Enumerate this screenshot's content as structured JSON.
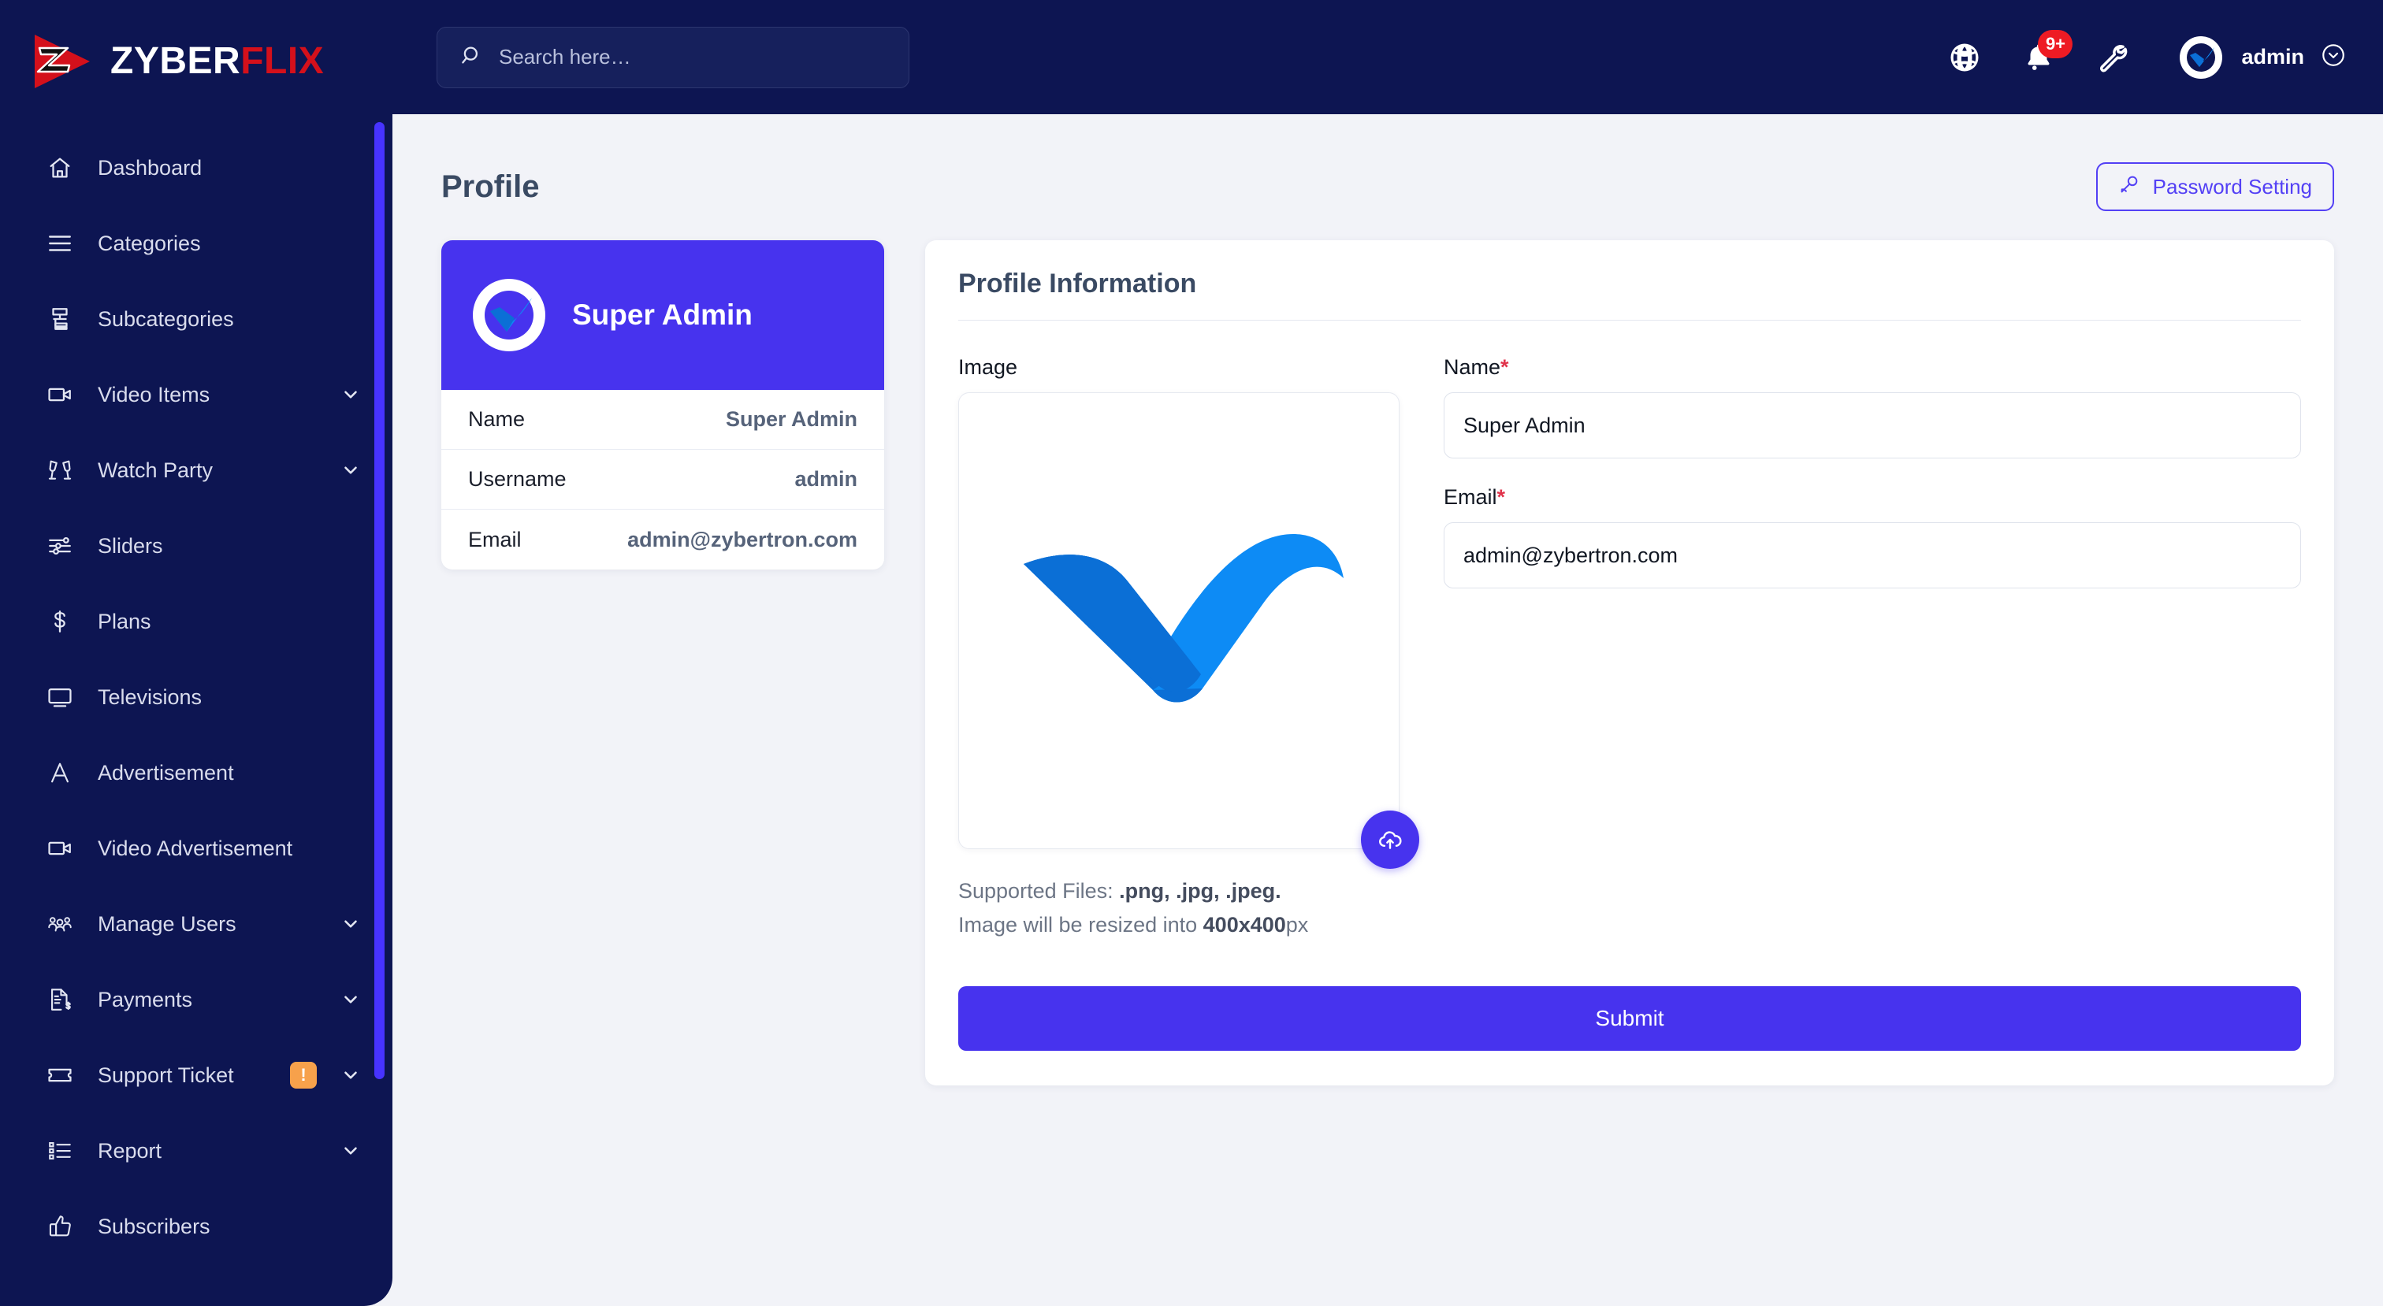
{
  "brand": {
    "name_white": "ZYBER",
    "name_red": "FLIX",
    "logo_icon": "play-z-logo-icon"
  },
  "sidebar": {
    "items": [
      {
        "label": "Dashboard",
        "icon": "home-icon",
        "chevron": false,
        "badge": null
      },
      {
        "label": "Categories",
        "icon": "list-lines-icon",
        "chevron": false,
        "badge": null
      },
      {
        "label": "Subcategories",
        "icon": "sitemap-icon",
        "chevron": false,
        "badge": null
      },
      {
        "label": "Video Items",
        "icon": "video-camera-icon",
        "chevron": true,
        "badge": null
      },
      {
        "label": "Watch Party",
        "icon": "cheers-glasses-icon",
        "chevron": true,
        "badge": null
      },
      {
        "label": "Sliders",
        "icon": "sliders-icon",
        "chevron": false,
        "badge": null
      },
      {
        "label": "Plans",
        "icon": "dollar-icon",
        "chevron": false,
        "badge": null
      },
      {
        "label": "Televisions",
        "icon": "monitor-icon",
        "chevron": false,
        "badge": null
      },
      {
        "label": "Advertisement",
        "icon": "letter-a-icon",
        "chevron": false,
        "badge": null
      },
      {
        "label": "Video Advertisement",
        "icon": "video-camera-icon",
        "chevron": false,
        "badge": null
      },
      {
        "label": "Manage Users",
        "icon": "users-group-icon",
        "chevron": true,
        "badge": null
      },
      {
        "label": "Payments",
        "icon": "invoice-dollar-icon",
        "chevron": true,
        "badge": null
      },
      {
        "label": "Support Ticket",
        "icon": "ticket-icon",
        "chevron": true,
        "badge": "!"
      },
      {
        "label": "Report",
        "icon": "bullet-list-icon",
        "chevron": true,
        "badge": null
      },
      {
        "label": "Subscribers",
        "icon": "thumbs-up-icon",
        "chevron": false,
        "badge": null
      }
    ]
  },
  "topbar": {
    "search": {
      "placeholder": "Search here…",
      "value": "",
      "icon": "search-icon"
    },
    "language_icon": "globe-icon",
    "notifications": {
      "icon": "bell-icon",
      "badge": "9+"
    },
    "settings_icon": "wrench-icon",
    "user": {
      "name": "admin",
      "avatar_icon": "check-avatar-icon",
      "caret_icon": "chevron-down-circle-icon"
    }
  },
  "page": {
    "title": "Profile",
    "password_button": {
      "label": "Password Setting",
      "icon": "key-icon"
    }
  },
  "profile_card": {
    "header_name": "Super Admin",
    "avatar_icon": "check-avatar-icon",
    "rows": [
      {
        "key": "Name",
        "value": "Super Admin"
      },
      {
        "key": "Username",
        "value": "admin"
      },
      {
        "key": "Email",
        "value": "admin@zybertron.com"
      }
    ]
  },
  "profile_form": {
    "title": "Profile Information",
    "image_label": "Image",
    "image_preview_icon": "blue-check-swoosh-icon",
    "upload_icon": "cloud-upload-icon",
    "hint_line1_prefix": "Supported Files: ",
    "hint_line1_bold": ".png, .jpg, .jpeg.",
    "hint_line2_prefix": "Image will be resized into ",
    "hint_line2_bold": "400x400",
    "hint_line2_suffix": "px",
    "name_label": "Name",
    "name_required": "*",
    "name_value": "Super Admin",
    "email_label": "Email",
    "email_required": "*",
    "email_value": "admin@zybertron.com",
    "submit_label": "Submit"
  },
  "colors": {
    "sidebar_bg": "#0d1552",
    "accent_purple": "#4733ee",
    "brand_red": "#d4101b",
    "badge_orange": "#f7a14b",
    "badge_red": "#ee1b24",
    "required_red": "#e0334b",
    "check_blue_dark": "#0b6fd6",
    "check_blue_light": "#0d8bf5",
    "page_bg": "#f2f3f8"
  }
}
